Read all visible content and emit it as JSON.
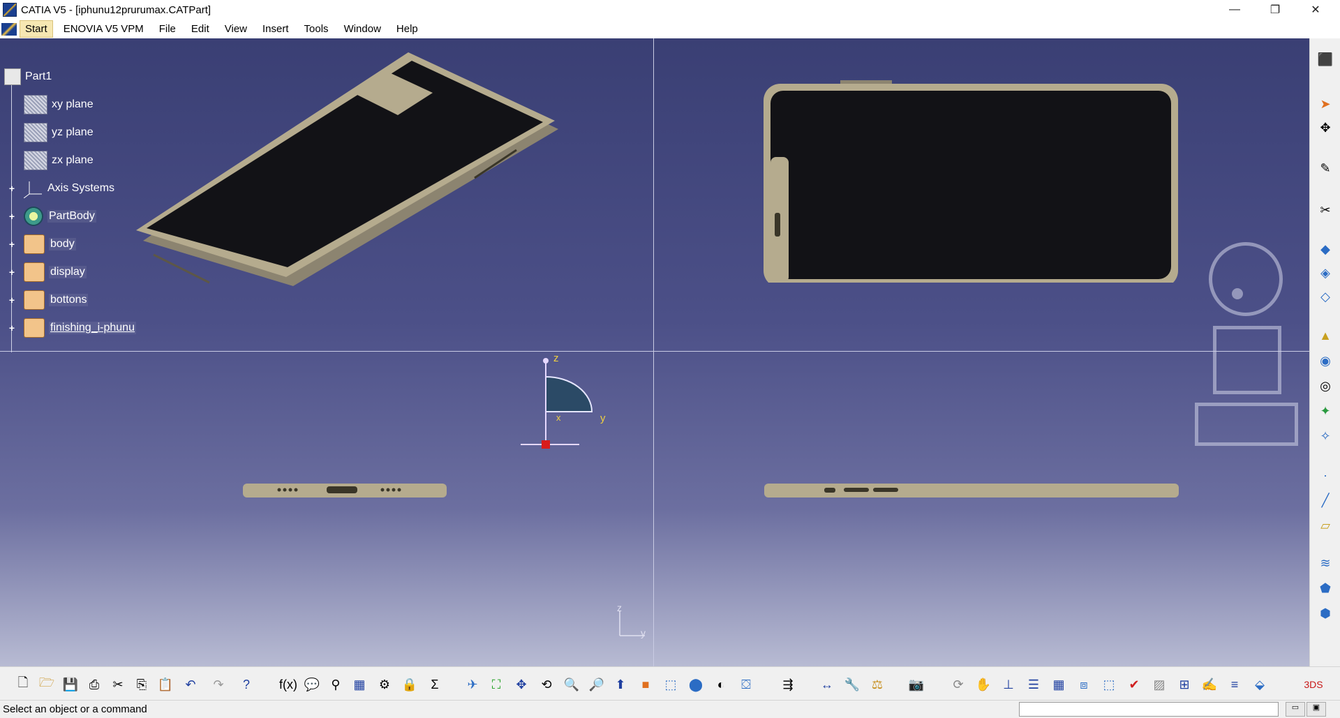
{
  "window": {
    "title": "CATIA V5 - [iphunu12prurumax.CATPart]",
    "minimize_glyph": "—",
    "restore_glyph": "❐",
    "close_glyph": "✕"
  },
  "menu": {
    "items": [
      {
        "label": "Start",
        "active": true
      },
      {
        "label": "ENOVIA V5 VPM",
        "active": false
      },
      {
        "label": "File",
        "active": false
      },
      {
        "label": "Edit",
        "active": false
      },
      {
        "label": "View",
        "active": false
      },
      {
        "label": "Insert",
        "active": false
      },
      {
        "label": "Tools",
        "active": false
      },
      {
        "label": "Window",
        "active": false
      },
      {
        "label": "Help",
        "active": false
      }
    ]
  },
  "tree": {
    "root": "Part1",
    "items": [
      {
        "label": "xy plane",
        "icon": "plane-icon"
      },
      {
        "label": "yz plane",
        "icon": "plane-icon"
      },
      {
        "label": "zx plane",
        "icon": "plane-icon"
      },
      {
        "label": "Axis Systems",
        "icon": "axis-system-icon"
      },
      {
        "label": "PartBody",
        "icon": "partbody-icon"
      },
      {
        "label": "body",
        "icon": "geometrical-set-icon"
      },
      {
        "label": "display",
        "icon": "geometrical-set-icon"
      },
      {
        "label": "bottons",
        "icon": "geometrical-set-icon"
      },
      {
        "label": "finishing_i-phunu",
        "icon": "geometrical-set-icon"
      }
    ]
  },
  "compass": {
    "z_label": "z",
    "y_label": "y",
    "x_label": "x"
  },
  "axis_triad": {
    "z_label": "z",
    "y_label": "y"
  },
  "status": {
    "message": "Select an object or a command",
    "command_input": ""
  },
  "colors": {
    "viewport_top": "#3a3f74",
    "viewport_bottom": "#b8bbd3",
    "phone_frame": "#b5ab8e",
    "screen": "#121216",
    "compass_fill": "#2b4a66"
  }
}
